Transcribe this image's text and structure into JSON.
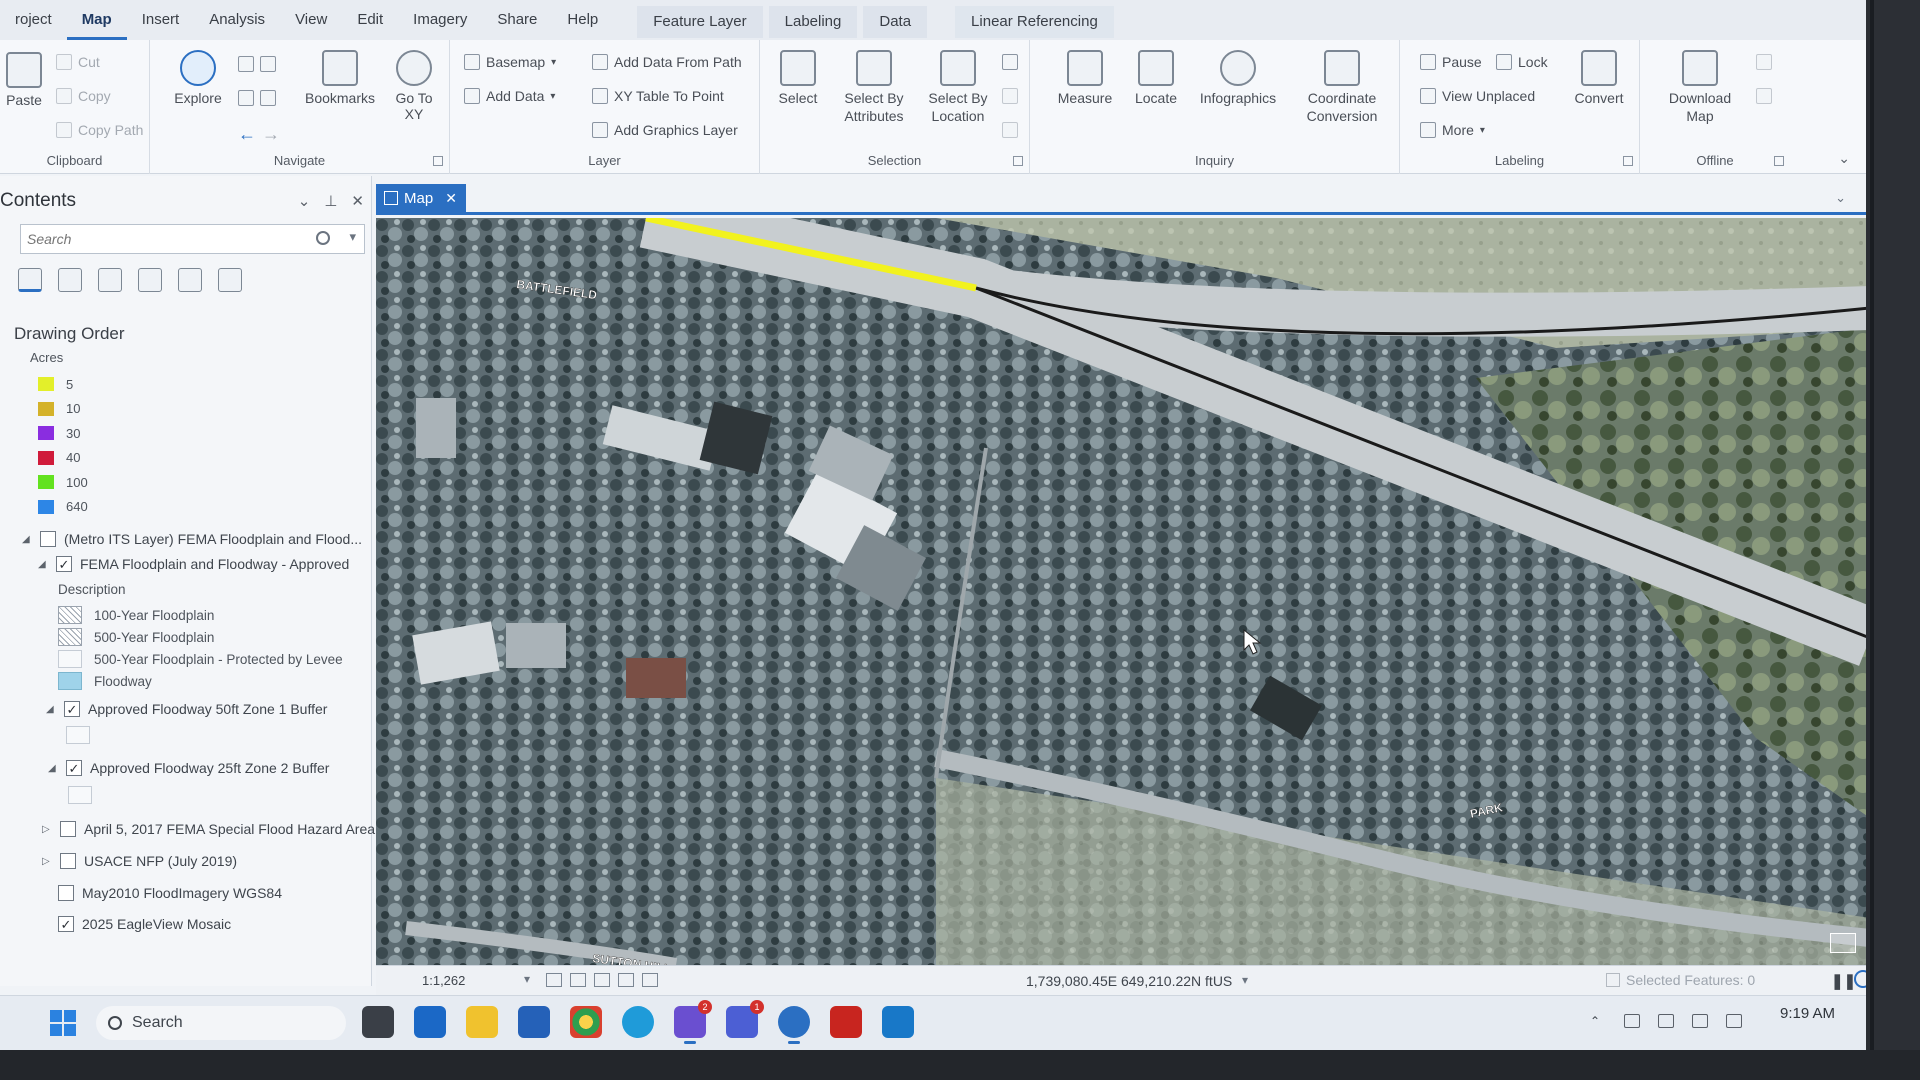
{
  "menu": {
    "items": [
      "roject",
      "Map",
      "Insert",
      "Analysis",
      "View",
      "Edit",
      "Imagery",
      "Share",
      "Help"
    ],
    "active": "Map",
    "contextual_tabs": [
      "Feature Layer",
      "Labeling",
      "Data"
    ],
    "extra_tab": "Linear Referencing"
  },
  "ribbon": {
    "clipboard": {
      "label": "Clipboard",
      "paste": "Paste",
      "cut": "Cut",
      "copy": "Copy",
      "copy_path": "Copy Path"
    },
    "navigate": {
      "label": "Navigate",
      "explore": "Explore",
      "bookmarks": "Bookmarks",
      "go_to_xy": "Go To XY"
    },
    "layer": {
      "label": "Layer",
      "basemap": "Basemap",
      "add_data": "Add Data",
      "add_data_from_path": "Add Data From Path",
      "xy_table_to_point": "XY Table To Point",
      "add_graphics_layer": "Add Graphics Layer"
    },
    "selection": {
      "label": "Selection",
      "select": "Select",
      "select_by_attributes": "Select By Attributes",
      "select_by_location": "Select By Location"
    },
    "inquiry": {
      "label": "Inquiry",
      "measure": "Measure",
      "locate": "Locate",
      "infographics": "Infographics",
      "coordinate_conversion": "Coordinate Conversion"
    },
    "labeling": {
      "label": "Labeling",
      "pause": "Pause",
      "lock": "Lock",
      "view_unplaced": "View Unplaced",
      "more": "More",
      "convert": "Convert"
    },
    "offline": {
      "label": "Offline",
      "download_map": "Download Map"
    }
  },
  "contents": {
    "title": "Contents",
    "search_placeholder": "Search",
    "drawing_order": "Drawing Order",
    "acres_label": "Acres",
    "acres_legend": [
      {
        "label": "5",
        "color": "#e3ef2a"
      },
      {
        "label": "10",
        "color": "#d4b22a"
      },
      {
        "label": "30",
        "color": "#8a2de0"
      },
      {
        "label": "40",
        "color": "#d01b3b"
      },
      {
        "label": "100",
        "color": "#62e21f"
      },
      {
        "label": "640",
        "color": "#2d86e6"
      }
    ],
    "layers": [
      {
        "name": "(Metro ITS Layer) FEMA Floodplain and Flood...",
        "checked": false
      },
      {
        "name": "FEMA Floodplain and Floodway - Approved",
        "checked": true
      },
      {
        "name": "Approved Floodway 50ft Zone 1 Buffer",
        "checked": true
      },
      {
        "name": "Approved Floodway 25ft Zone 2 Buffer",
        "checked": true
      },
      {
        "name": "April 5, 2017 FEMA Special Flood Hazard Area",
        "checked": false
      },
      {
        "name": "USACE NFP (July 2019)",
        "checked": false
      },
      {
        "name": "May2010 FloodImagery WGS84",
        "checked": false
      },
      {
        "name": "2025 EagleView Mosaic",
        "checked": true
      }
    ],
    "description_label": "Description",
    "fema_classes": [
      "100-Year Floodplain",
      "500-Year Floodplain",
      "500-Year Floodplain - Protected by Levee",
      "Floodway"
    ],
    "checkmark": "✓"
  },
  "map": {
    "tab_label": "Map",
    "close_glyph": "✕",
    "street_labels": [
      "BATTLEFIELD",
      "PARK",
      "SUTTON HILL"
    ],
    "scale": "1:1,262",
    "coordinates": "1,739,080.45E 649,210.22N ftUS",
    "selected_features": "Selected Features: 0",
    "accent_color": "#2b6fc2",
    "highlight_color": "#f2f21e"
  },
  "taskbar": {
    "search_label": "Search",
    "badges": [
      "2",
      "1"
    ],
    "clock_time": "9:19 AM"
  }
}
